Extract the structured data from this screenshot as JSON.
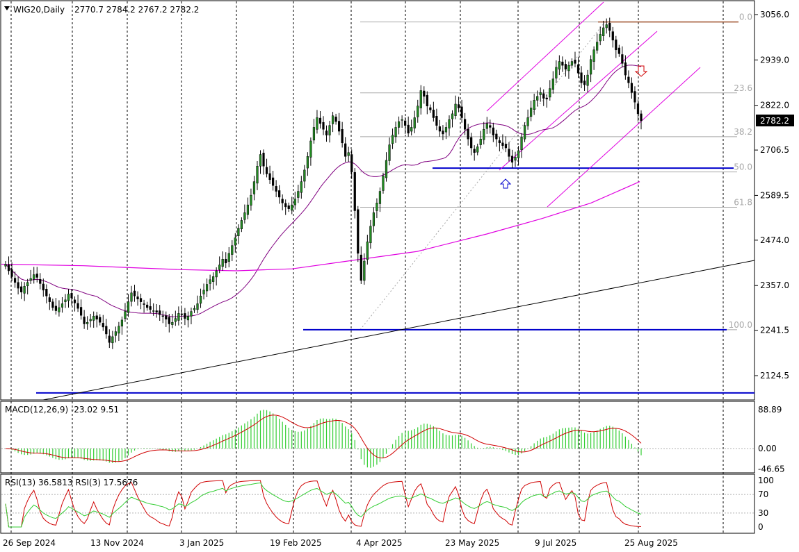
{
  "chart_data": {
    "type": "candlestick",
    "symbol_header": "WIG20,Daily",
    "ohlc_header": "2770.7 2784.2 2767.2 2782.2",
    "current_price_label": "2782.2",
    "current_price": 2782.2,
    "y_ticks": [
      "3056.0",
      "2939.0",
      "2822.0",
      "2706.5",
      "2589.5",
      "2474.0",
      "2357.0",
      "2241.5",
      "2124.5"
    ],
    "ylim": [
      2100,
      3070
    ],
    "x_tick_labels": [
      "26 Sep 2024",
      "13 Nov 2024",
      "3 Jan 2025",
      "19 Feb 2025",
      "4 Apr 2025",
      "23 May 2025",
      "9 Jul 2025",
      "25 Aug 2025"
    ],
    "fibonacci": {
      "levels": [
        {
          "label": "0.0",
          "price": 3037
        },
        {
          "label": "23.6",
          "price": 2854
        },
        {
          "label": "38.2",
          "price": 2741
        },
        {
          "label": "50.0",
          "price": 2650
        },
        {
          "label": "61.8",
          "price": 2559
        },
        {
          "label": "100.0",
          "price": 2243
        }
      ]
    },
    "horizontal_lines": [
      {
        "name": "support-upper",
        "price": 2660,
        "color": "#0000cc"
      },
      {
        "name": "support-mid",
        "price": 2243,
        "color": "#0000cc"
      },
      {
        "name": "support-low",
        "price": 2080,
        "color": "#0000cc"
      },
      {
        "name": "resistance",
        "price": 3037,
        "color": "#a0522d"
      }
    ],
    "close_series": [
      2412,
      2395,
      2380,
      2365,
      2350,
      2340,
      2355,
      2365,
      2375,
      2385,
      2378,
      2362,
      2345,
      2330,
      2315,
      2300,
      2292,
      2300,
      2310,
      2320,
      2335,
      2325,
      2312,
      2298,
      2280,
      2258,
      2262,
      2270,
      2278,
      2270,
      2262,
      2250,
      2232,
      2210,
      2225,
      2238,
      2252,
      2268,
      2290,
      2315,
      2338,
      2330,
      2322,
      2315,
      2308,
      2300,
      2295,
      2292,
      2288,
      2282,
      2278,
      2270,
      2258,
      2262,
      2272,
      2285,
      2282,
      2272,
      2278,
      2290,
      2298,
      2310,
      2330,
      2345,
      2360,
      2372,
      2380,
      2395,
      2410,
      2425,
      2415,
      2440,
      2460,
      2480,
      2505,
      2525,
      2545,
      2565,
      2590,
      2625,
      2665,
      2695,
      2665,
      2645,
      2630,
      2615,
      2600,
      2585,
      2570,
      2560,
      2555,
      2565,
      2580,
      2600,
      2625,
      2655,
      2690,
      2730,
      2765,
      2790,
      2775,
      2760,
      2745,
      2770,
      2795,
      2780,
      2755,
      2725,
      2690,
      2700,
      2650,
      2550,
      2440,
      2370,
      2420,
      2470,
      2510,
      2545,
      2570,
      2600,
      2640,
      2680,
      2720,
      2745,
      2765,
      2780,
      2785,
      2770,
      2750,
      2765,
      2790,
      2820,
      2860,
      2845,
      2820,
      2810,
      2790,
      2770,
      2755,
      2748,
      2765,
      2785,
      2800,
      2825,
      2815,
      2790,
      2760,
      2735,
      2712,
      2700,
      2715,
      2735,
      2760,
      2775,
      2765,
      2745,
      2735,
      2725,
      2718,
      2712,
      2690,
      2675,
      2688,
      2705,
      2740,
      2770,
      2790,
      2815,
      2835,
      2845,
      2855,
      2840,
      2838,
      2865,
      2890,
      2920,
      2935,
      2925,
      2915,
      2925,
      2935,
      2930,
      2905,
      2880,
      2875,
      2900,
      2940,
      2965,
      2985,
      3005,
      3022,
      3030,
      3015,
      2990,
      2965,
      2955,
      2930,
      2900,
      2880,
      2855,
      2830,
      2800,
      2782
    ],
    "indicators": {
      "macd": {
        "label": "MACD(12,26,9) -23.02 9.51",
        "y_ticks": [
          "88.89",
          "0.00",
          "-46.65"
        ],
        "ylim": [
          -55,
          95
        ]
      },
      "rsi": {
        "label": "RSI(13) 36.5813  RSI(3) 17.5676",
        "y_ticks": [
          "100",
          "70",
          "30",
          "0"
        ],
        "ylim": [
          0,
          100
        ]
      }
    }
  }
}
